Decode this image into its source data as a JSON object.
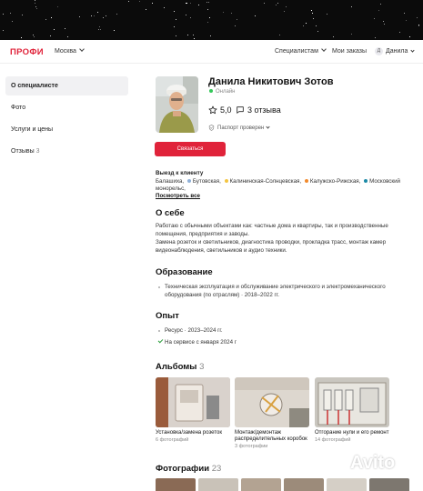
{
  "header": {
    "logo": "ПРОФИ",
    "city": "Москва",
    "nav_specialists": "Специалистам",
    "nav_orders": "Мои заказы",
    "user_initial": "Д",
    "user_name": "Данила"
  },
  "sidebar": {
    "items": [
      {
        "label": "О специалисте",
        "active": true
      },
      {
        "label": "Фото"
      },
      {
        "label": "Услуги и цены"
      },
      {
        "label": "Отзывы",
        "count": "3"
      }
    ]
  },
  "profile": {
    "name": "Данила Никитович Зотов",
    "status": "Онлайн",
    "rating": "5,0",
    "reviews": "3 отзыва",
    "passport": "Паспорт проверен",
    "contact_button": "Связаться"
  },
  "visit": {
    "heading": "Выезд к клиенту",
    "line1_a": "Балашиха,",
    "line1_b": "Бутовская,",
    "line1_c": "Калининская-Солнцевская,",
    "line1_d": "Калужско-Рижская,",
    "line1_e": "Московский",
    "line2": "монорельс,",
    "show_all": "Посмотреть все",
    "colors": [
      "#8fb0d8",
      "#f4c542",
      "#f18a2c",
      "#1b8aa7"
    ]
  },
  "about": {
    "heading": "О себе",
    "p1": "Работаю с обычными объектами как: частные дома и квартиры, так и производственные",
    "p2": "помещения, предприятия и заводы.",
    "p3": "Замена розеток и светильников, диагностика проводки, прокладка трасс, монтаж камер",
    "p4": "видеонаблюдения, светильников и аудио техники."
  },
  "education": {
    "heading": "Образование",
    "line1": "Техническая эксплуатация и обслуживание электрического и электромеханического",
    "line2": "оборудования (по отраслям) · 2018–2022 гг."
  },
  "experience": {
    "heading": "Опыт",
    "item1": "Ресурс · 2023–2024 гг.",
    "item2": "На сервисе с января 2024 г"
  },
  "albums": {
    "heading": "Альбомы",
    "count": "3",
    "items": [
      {
        "title": "Установка/замена розеток",
        "sub": "6 фотографий"
      },
      {
        "title": "Монтаж/демонтаж",
        "title2": "распределительных коробок",
        "sub": "3 фотографии"
      },
      {
        "title": "Отгорание нули и его ремонт",
        "sub": "14 фотографий"
      }
    ]
  },
  "photos": {
    "heading": "Фотографии",
    "count": "23"
  },
  "watermark": "Avito"
}
